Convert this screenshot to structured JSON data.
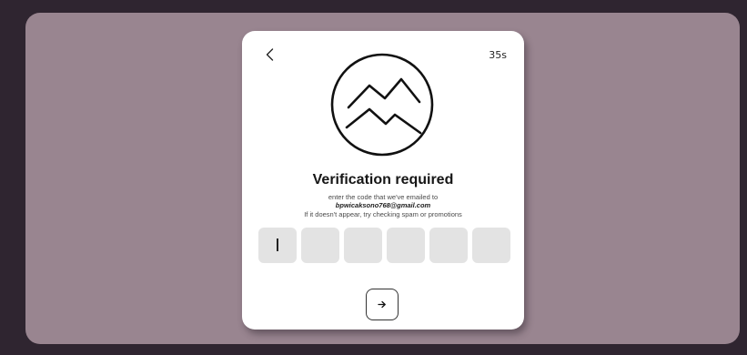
{
  "header": {
    "back_icon": "chevron-left-icon",
    "timer": "35s"
  },
  "logo": {
    "icon": "mountain-logo-icon"
  },
  "content": {
    "title": "Verification required",
    "line1": "enter the code that we've emailed to",
    "email": "bpwicaksono768@gmail.com",
    "line3": "If it doesn't appear, try checking spam or promotions"
  },
  "otp": {
    "length": 6,
    "values": [
      "",
      "",
      "",
      "",
      "",
      ""
    ],
    "box_color": "#e3e3e3"
  },
  "next_button": {
    "icon": "arrow-right-icon"
  },
  "colors": {
    "backdrop": "#2f2530",
    "stage": "#998590",
    "card": "#ffffff"
  }
}
